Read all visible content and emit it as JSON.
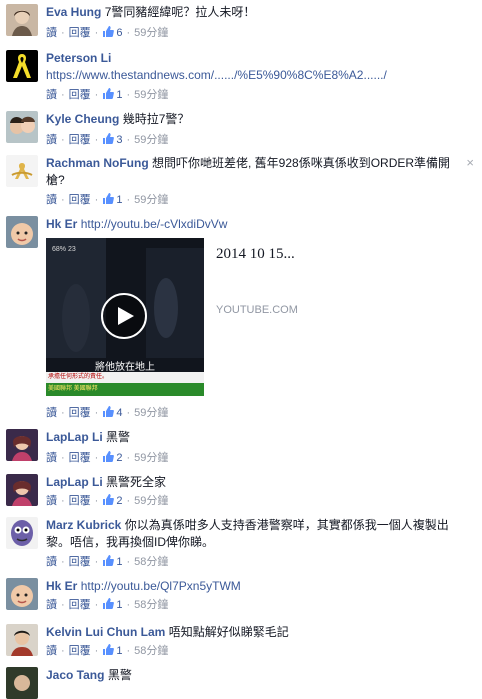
{
  "actions": {
    "reply": "回覆",
    "read": "讀"
  },
  "close_glyph": "×",
  "comments": [
    {
      "name": "Eva Hung",
      "text": "7警同豬經緯呢？拉人未呀！",
      "likes": "6",
      "time": "59分鐘"
    },
    {
      "name": "Peterson Li",
      "link": "https://www.thestandnews.com/....../%E5%90%8C%E8%A2....../",
      "likes": "1",
      "time": "59分鐘"
    },
    {
      "name": "Kyle Cheung",
      "text": "幾時拉7警？",
      "likes": "3",
      "time": "59分鐘"
    },
    {
      "name": "Rachman NoFung",
      "text": "想問吓你哋班差佬, 舊年928係咪真係收到ORDER準備開槍?",
      "likes": "1",
      "time": "59分鐘"
    },
    {
      "name": "Hk Er",
      "link": "http://youtu.be/-cVlxdiDvVw",
      "likes": "4",
      "time": "59分鐘",
      "video": {
        "title": "2014 10 15...",
        "source": "YOUTUBE.COM",
        "thumb_top": "68% 23",
        "thumb_caption": "將他放在地上",
        "thumb_bar1": "承擔任何形式的責任。",
        "thumb_bar2": "美國聯邦 美國聯邦"
      }
    },
    {
      "name": "LapLap Li",
      "text": "黑警",
      "likes": "2",
      "time": "59分鐘"
    },
    {
      "name": "LapLap Li",
      "text": "黑警死全家",
      "likes": "2",
      "time": "59分鐘"
    },
    {
      "name": "Marz Kubrick",
      "text": "你以為真係咁多人支持香港警察咩，其實都係我一個人複製出黎。唔信，我再換個ID俾你睇。",
      "likes": "1",
      "time": "58分鐘"
    },
    {
      "name": "Hk Er",
      "link": "http://youtu.be/Ql7Pxn5yTWM",
      "likes": "1",
      "time": "58分鐘"
    },
    {
      "name": "Kelvin Lui Chun Lam",
      "text": "唔知點解好似睇緊毛記",
      "likes": "1",
      "time": "58分鐘"
    },
    {
      "name": "Jaco Tang",
      "text": "黑警"
    }
  ]
}
